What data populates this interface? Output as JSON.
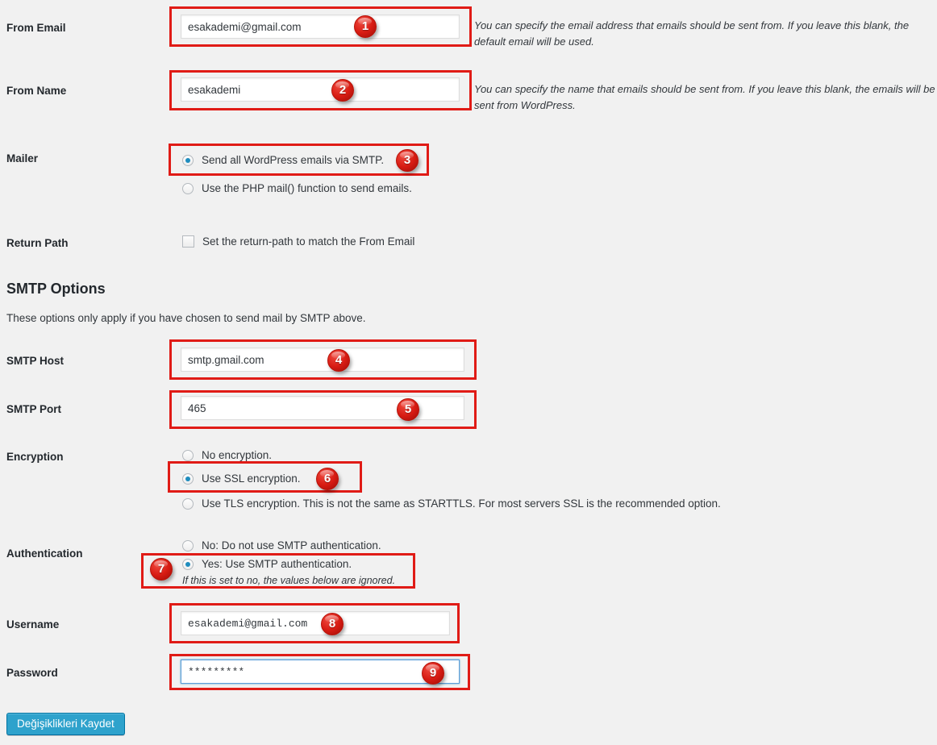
{
  "page": {
    "background_color": "#f1f1f1",
    "accent_color": "#2ea2cc",
    "annotation_color": "#e01b16"
  },
  "fields": {
    "from_email": {
      "label": "From Email",
      "value": "esakademi@gmail.com",
      "description": "You can specify the email address that emails should be sent from. If you leave this blank, the default email will be used."
    },
    "from_name": {
      "label": "From Name",
      "value": "esakademi",
      "description": "You can specify the name that emails should be sent from. If you leave this blank, the emails will be sent from WordPress."
    },
    "mailer": {
      "label": "Mailer",
      "options": [
        {
          "text": "Send all WordPress emails via SMTP.",
          "checked": true
        },
        {
          "text": "Use the PHP mail() function to send emails.",
          "checked": false
        }
      ]
    },
    "return_path": {
      "label": "Return Path",
      "option": {
        "text": "Set the return-path to match the From Email",
        "checked": false
      }
    },
    "smtp_host": {
      "label": "SMTP Host",
      "value": "smtp.gmail.com"
    },
    "smtp_port": {
      "label": "SMTP Port",
      "value": "465"
    },
    "encryption": {
      "label": "Encryption",
      "options": [
        {
          "text": "No encryption.",
          "checked": false
        },
        {
          "text": "Use SSL encryption.",
          "checked": true
        },
        {
          "text": "Use TLS encryption. This is not the same as STARTTLS. For most servers SSL is the recommended option.",
          "checked": false
        }
      ]
    },
    "authentication": {
      "label": "Authentication",
      "options": [
        {
          "text": "No: Do not use SMTP authentication.",
          "checked": false
        },
        {
          "text": "Yes: Use SMTP authentication.",
          "checked": true
        }
      ],
      "note": "If this is set to no, the values below are ignored."
    },
    "username": {
      "label": "Username",
      "value": "esakademi@gmail.com"
    },
    "password": {
      "label": "Password",
      "value": "*********"
    }
  },
  "section": {
    "title": "SMTP Options",
    "description": "These options only apply if you have chosen to send mail by SMTP above."
  },
  "submit": {
    "label": "Değişiklikleri Kaydet"
  },
  "annotations": {
    "badges": [
      "1",
      "2",
      "3",
      "4",
      "5",
      "6",
      "7",
      "8",
      "9"
    ]
  }
}
